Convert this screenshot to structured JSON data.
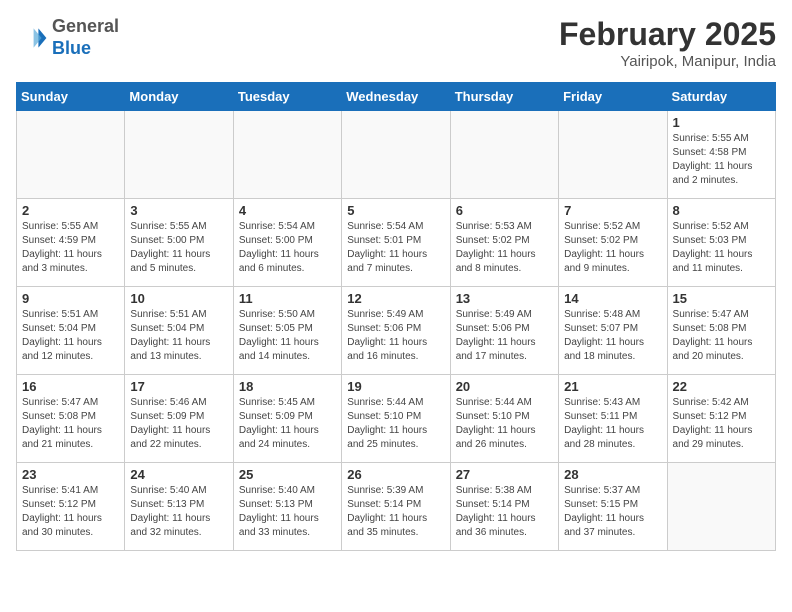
{
  "header": {
    "logo_line1": "General",
    "logo_line2": "Blue",
    "month_year": "February 2025",
    "location": "Yairipok, Manipur, India"
  },
  "weekdays": [
    "Sunday",
    "Monday",
    "Tuesday",
    "Wednesday",
    "Thursday",
    "Friday",
    "Saturday"
  ],
  "weeks": [
    [
      {
        "day": "",
        "info": ""
      },
      {
        "day": "",
        "info": ""
      },
      {
        "day": "",
        "info": ""
      },
      {
        "day": "",
        "info": ""
      },
      {
        "day": "",
        "info": ""
      },
      {
        "day": "",
        "info": ""
      },
      {
        "day": "1",
        "info": "Sunrise: 5:55 AM\nSunset: 4:58 PM\nDaylight: 11 hours and 2 minutes."
      }
    ],
    [
      {
        "day": "2",
        "info": "Sunrise: 5:55 AM\nSunset: 4:59 PM\nDaylight: 11 hours and 3 minutes."
      },
      {
        "day": "3",
        "info": "Sunrise: 5:55 AM\nSunset: 5:00 PM\nDaylight: 11 hours and 5 minutes."
      },
      {
        "day": "4",
        "info": "Sunrise: 5:54 AM\nSunset: 5:00 PM\nDaylight: 11 hours and 6 minutes."
      },
      {
        "day": "5",
        "info": "Sunrise: 5:54 AM\nSunset: 5:01 PM\nDaylight: 11 hours and 7 minutes."
      },
      {
        "day": "6",
        "info": "Sunrise: 5:53 AM\nSunset: 5:02 PM\nDaylight: 11 hours and 8 minutes."
      },
      {
        "day": "7",
        "info": "Sunrise: 5:52 AM\nSunset: 5:02 PM\nDaylight: 11 hours and 9 minutes."
      },
      {
        "day": "8",
        "info": "Sunrise: 5:52 AM\nSunset: 5:03 PM\nDaylight: 11 hours and 11 minutes."
      }
    ],
    [
      {
        "day": "9",
        "info": "Sunrise: 5:51 AM\nSunset: 5:04 PM\nDaylight: 11 hours and 12 minutes."
      },
      {
        "day": "10",
        "info": "Sunrise: 5:51 AM\nSunset: 5:04 PM\nDaylight: 11 hours and 13 minutes."
      },
      {
        "day": "11",
        "info": "Sunrise: 5:50 AM\nSunset: 5:05 PM\nDaylight: 11 hours and 14 minutes."
      },
      {
        "day": "12",
        "info": "Sunrise: 5:49 AM\nSunset: 5:06 PM\nDaylight: 11 hours and 16 minutes."
      },
      {
        "day": "13",
        "info": "Sunrise: 5:49 AM\nSunset: 5:06 PM\nDaylight: 11 hours and 17 minutes."
      },
      {
        "day": "14",
        "info": "Sunrise: 5:48 AM\nSunset: 5:07 PM\nDaylight: 11 hours and 18 minutes."
      },
      {
        "day": "15",
        "info": "Sunrise: 5:47 AM\nSunset: 5:08 PM\nDaylight: 11 hours and 20 minutes."
      }
    ],
    [
      {
        "day": "16",
        "info": "Sunrise: 5:47 AM\nSunset: 5:08 PM\nDaylight: 11 hours and 21 minutes."
      },
      {
        "day": "17",
        "info": "Sunrise: 5:46 AM\nSunset: 5:09 PM\nDaylight: 11 hours and 22 minutes."
      },
      {
        "day": "18",
        "info": "Sunrise: 5:45 AM\nSunset: 5:09 PM\nDaylight: 11 hours and 24 minutes."
      },
      {
        "day": "19",
        "info": "Sunrise: 5:44 AM\nSunset: 5:10 PM\nDaylight: 11 hours and 25 minutes."
      },
      {
        "day": "20",
        "info": "Sunrise: 5:44 AM\nSunset: 5:10 PM\nDaylight: 11 hours and 26 minutes."
      },
      {
        "day": "21",
        "info": "Sunrise: 5:43 AM\nSunset: 5:11 PM\nDaylight: 11 hours and 28 minutes."
      },
      {
        "day": "22",
        "info": "Sunrise: 5:42 AM\nSunset: 5:12 PM\nDaylight: 11 hours and 29 minutes."
      }
    ],
    [
      {
        "day": "23",
        "info": "Sunrise: 5:41 AM\nSunset: 5:12 PM\nDaylight: 11 hours and 30 minutes."
      },
      {
        "day": "24",
        "info": "Sunrise: 5:40 AM\nSunset: 5:13 PM\nDaylight: 11 hours and 32 minutes."
      },
      {
        "day": "25",
        "info": "Sunrise: 5:40 AM\nSunset: 5:13 PM\nDaylight: 11 hours and 33 minutes."
      },
      {
        "day": "26",
        "info": "Sunrise: 5:39 AM\nSunset: 5:14 PM\nDaylight: 11 hours and 35 minutes."
      },
      {
        "day": "27",
        "info": "Sunrise: 5:38 AM\nSunset: 5:14 PM\nDaylight: 11 hours and 36 minutes."
      },
      {
        "day": "28",
        "info": "Sunrise: 5:37 AM\nSunset: 5:15 PM\nDaylight: 11 hours and 37 minutes."
      },
      {
        "day": "",
        "info": ""
      }
    ]
  ]
}
